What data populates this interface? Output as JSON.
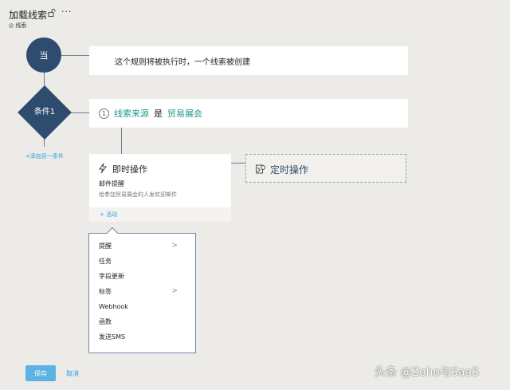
{
  "header": {
    "title": "加载线索",
    "more": "···",
    "module_label": "线索"
  },
  "flow": {
    "when_label": "当",
    "trigger_text": "这个规则将被执行时，一个线索被创建",
    "condition_label": "条件1",
    "add_condition": "+添加另一条件",
    "condition": {
      "number": "1",
      "field": "线索来源",
      "operator": "是",
      "value": "贸易展会"
    }
  },
  "instant_action": {
    "title": "即时操作",
    "item_title": "邮件提醒",
    "item_desc": "给参加贸易展会的人发欢迎邮件",
    "add_activity": "+ 活动"
  },
  "scheduled_action": {
    "title": "定时操作"
  },
  "menu": {
    "items": [
      {
        "label": "提醒",
        "submenu": true
      },
      {
        "label": "任务",
        "submenu": false
      },
      {
        "label": "字段更新",
        "submenu": false
      },
      {
        "label": "标签",
        "submenu": true
      },
      {
        "label": "Webhook",
        "submenu": false
      },
      {
        "label": "函数",
        "submenu": false
      },
      {
        "label": "发送SMS",
        "submenu": false
      }
    ]
  },
  "footer": {
    "save": "保存",
    "cancel": "取消"
  },
  "watermark": "头条 @Zoho与SaaS",
  "colors": {
    "node": "#2d4c6e",
    "accent": "#1a9b8a",
    "link": "#2e9fd6",
    "save": "#5ab3e4"
  }
}
